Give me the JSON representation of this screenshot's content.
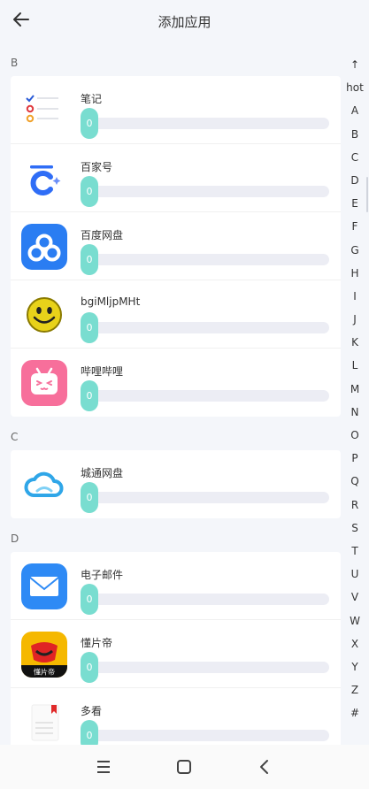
{
  "header": {
    "title": "添加应用"
  },
  "sections": [
    {
      "letter": "B",
      "apps": [
        {
          "name": "笔记",
          "value": "0",
          "icon": "notes-icon"
        },
        {
          "name": "百家号",
          "value": "0",
          "icon": "baijiahao-icon"
        },
        {
          "name": "百度网盘",
          "value": "0",
          "icon": "baidu-netdisk-icon"
        },
        {
          "name": "bgiMljpMHt",
          "value": "0",
          "icon": "smiley-icon"
        },
        {
          "name": "哔哩哔哩",
          "value": "0",
          "icon": "bilibili-icon"
        }
      ]
    },
    {
      "letter": "C",
      "apps": [
        {
          "name": "城通网盘",
          "value": "0",
          "icon": "cloud-icon"
        }
      ]
    },
    {
      "letter": "D",
      "apps": [
        {
          "name": "电子邮件",
          "value": "0",
          "icon": "mail-icon"
        },
        {
          "name": "懂片帝",
          "value": "0",
          "icon": "dongpiandi-icon"
        },
        {
          "name": "多看",
          "value": "0",
          "icon": "duokan-icon"
        }
      ]
    }
  ],
  "index_bar": [
    "↑",
    "hot",
    "A",
    "B",
    "C",
    "D",
    "E",
    "F",
    "G",
    "H",
    "I",
    "J",
    "K",
    "L",
    "M",
    "N",
    "O",
    "P",
    "Q",
    "R",
    "S",
    "T",
    "U",
    "V",
    "W",
    "X",
    "Y",
    "Z",
    "#"
  ],
  "icons": {
    "back": "arrow-left-icon",
    "nav_menu": "menu-icon",
    "nav_home": "home-square-icon",
    "nav_back": "chevron-left-icon"
  },
  "colors": {
    "background": "#f4f6fa",
    "slider_thumb": "#79ddd0",
    "slider_track": "#ecedf4",
    "bilibili_pink": "#f76f9b",
    "baidu_blue": "#2a7df2",
    "mail_blue": "#2e8af5"
  },
  "icon_labels": {
    "dongpiandi": "懂片帝"
  }
}
